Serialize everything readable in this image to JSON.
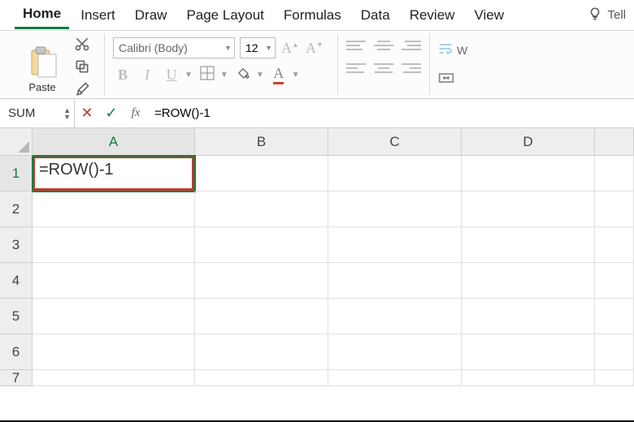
{
  "tabs": {
    "items": [
      "Home",
      "Insert",
      "Draw",
      "Page Layout",
      "Formulas",
      "Data",
      "Review",
      "View"
    ],
    "active_index": 0,
    "tell_me": "Tell"
  },
  "ribbon": {
    "clipboard": {
      "paste": "Paste"
    },
    "font": {
      "name": "Calibri (Body)",
      "size": "12",
      "bold": "B",
      "italic": "I",
      "underline": "U"
    },
    "wrap": {
      "wrap_text_abbr": "W"
    }
  },
  "formula_bar": {
    "name_box": "SUM",
    "cancel_glyph": "✕",
    "accept_glyph": "✓",
    "fx_label": "fx",
    "input": "=ROW()-1"
  },
  "sheet": {
    "columns": [
      "A",
      "B",
      "C",
      "D",
      ""
    ],
    "rows": [
      {
        "num": "1",
        "cells": [
          "=ROW()-1",
          "",
          "",
          "",
          ""
        ]
      },
      {
        "num": "2",
        "cells": [
          "",
          "",
          "",
          "",
          ""
        ]
      },
      {
        "num": "3",
        "cells": [
          "",
          "",
          "",
          "",
          ""
        ]
      },
      {
        "num": "4",
        "cells": [
          "",
          "",
          "",
          "",
          ""
        ]
      },
      {
        "num": "5",
        "cells": [
          "",
          "",
          "",
          "",
          ""
        ]
      },
      {
        "num": "6",
        "cells": [
          "",
          "",
          "",
          "",
          ""
        ]
      },
      {
        "num": "7",
        "cells": [
          "",
          "",
          "",
          "",
          ""
        ]
      }
    ],
    "active_cell": {
      "row": 0,
      "col": 0
    }
  }
}
